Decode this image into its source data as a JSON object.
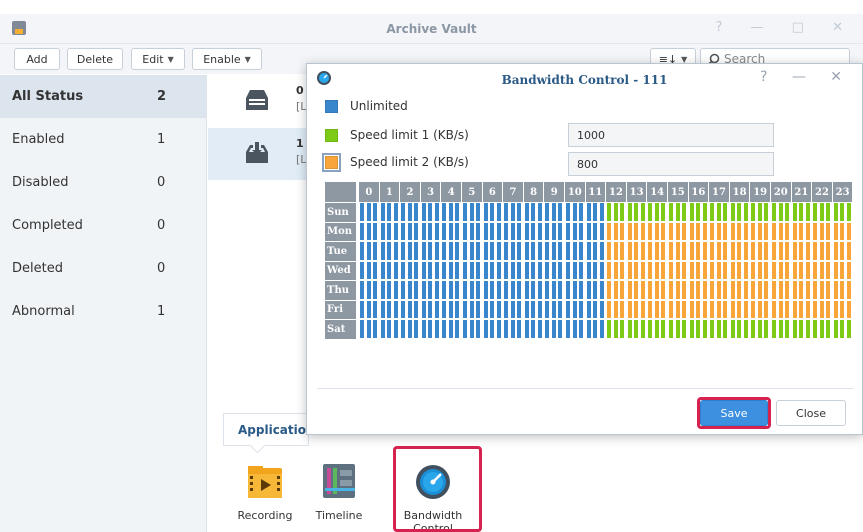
{
  "window": {
    "title": "Archive Vault",
    "controls": "? — □ ✕"
  },
  "toolbar": {
    "add": "Add",
    "delete": "Delete",
    "edit": "Edit",
    "enable": "Enable",
    "sort": "≡↓",
    "search_placeholder": "Search"
  },
  "sidebar": {
    "items": [
      {
        "label": "All Status",
        "count": "2"
      },
      {
        "label": "Enabled",
        "count": "1"
      },
      {
        "label": "Disabled",
        "count": "0"
      },
      {
        "label": "Completed",
        "count": "0"
      },
      {
        "label": "Deleted",
        "count": "0"
      },
      {
        "label": "Abnormal",
        "count": "1"
      }
    ]
  },
  "list": {
    "rows": [
      {
        "line1": "0",
        "line2": "[L"
      },
      {
        "line1": "1",
        "line2": "[L"
      }
    ]
  },
  "dialog": {
    "title": "Bandwidth Control - 111",
    "controls": "? — ✕",
    "legend": {
      "unlimited": "Unlimited",
      "limit1": "Speed limit 1 (KB/s)",
      "limit2": "Speed limit 2 (KB/s)"
    },
    "limit1_value": "1000",
    "limit2_value": "800",
    "save": "Save",
    "close": "Close"
  },
  "colors": {
    "unlimited": "#3a86cd",
    "limit1": "#7dcb16",
    "limit2": "#f8a53a",
    "highlight": "#d6224f"
  },
  "schedule": {
    "hours": [
      "0",
      "1",
      "2",
      "3",
      "4",
      "5",
      "6",
      "7",
      "8",
      "9",
      "10",
      "11",
      "12",
      "13",
      "14",
      "15",
      "16",
      "17",
      "18",
      "19",
      "20",
      "21",
      "22",
      "23"
    ],
    "days": [
      "Sun",
      "Mon",
      "Tue",
      "Wed",
      "Thu",
      "Fri",
      "Sat"
    ],
    "rows": [
      [
        "U",
        "U",
        "U",
        "U",
        "U",
        "U",
        "U",
        "U",
        "U",
        "U",
        "U",
        "U",
        "L1",
        "L1",
        "L1",
        "L1",
        "L1",
        "L1",
        "L1",
        "L1",
        "L1",
        "L1",
        "L1",
        "L1"
      ],
      [
        "U",
        "U",
        "U",
        "U",
        "U",
        "U",
        "U",
        "U",
        "U",
        "U",
        "U",
        "U",
        "L2",
        "L2",
        "L2",
        "L2",
        "L2",
        "L2",
        "L2",
        "L2",
        "L2",
        "L2",
        "L2",
        "L2"
      ],
      [
        "U",
        "U",
        "U",
        "U",
        "U",
        "U",
        "U",
        "U",
        "U",
        "U",
        "U",
        "U",
        "L2",
        "L2",
        "L2",
        "L2",
        "L2",
        "L2",
        "L2",
        "L2",
        "L2",
        "L2",
        "L2",
        "L2"
      ],
      [
        "U",
        "U",
        "U",
        "U",
        "U",
        "U",
        "U",
        "U",
        "U",
        "U",
        "U",
        "U",
        "L2",
        "L2",
        "L2",
        "L2",
        "L2",
        "L2",
        "L2",
        "L2",
        "L2",
        "L2",
        "L2",
        "L2"
      ],
      [
        "U",
        "U",
        "U",
        "U",
        "U",
        "U",
        "U",
        "U",
        "U",
        "U",
        "U",
        "U",
        "L2",
        "L2",
        "L2",
        "L2",
        "L2",
        "L2",
        "L2",
        "L2",
        "L2",
        "L2",
        "L2",
        "L2"
      ],
      [
        "U",
        "U",
        "U",
        "U",
        "U",
        "U",
        "U",
        "U",
        "U",
        "U",
        "U",
        "U",
        "L2",
        "L2",
        "L2",
        "L2",
        "L2",
        "L2",
        "L2",
        "L2",
        "L2",
        "L2",
        "L2",
        "L2"
      ],
      [
        "U",
        "U",
        "U",
        "U",
        "U",
        "U",
        "U",
        "U",
        "U",
        "U",
        "U",
        "U",
        "L1",
        "L1",
        "L1",
        "L1",
        "L1",
        "L1",
        "L1",
        "L1",
        "L1",
        "L1",
        "L1",
        "L1"
      ]
    ]
  },
  "apps": {
    "tab": "Applications",
    "items": [
      {
        "label": "Recording",
        "icon": "recording-icon"
      },
      {
        "label": "Timeline",
        "icon": "timeline-icon"
      },
      {
        "label": "Bandwidth Control",
        "icon": "bandwidth-gauge-icon"
      }
    ]
  }
}
